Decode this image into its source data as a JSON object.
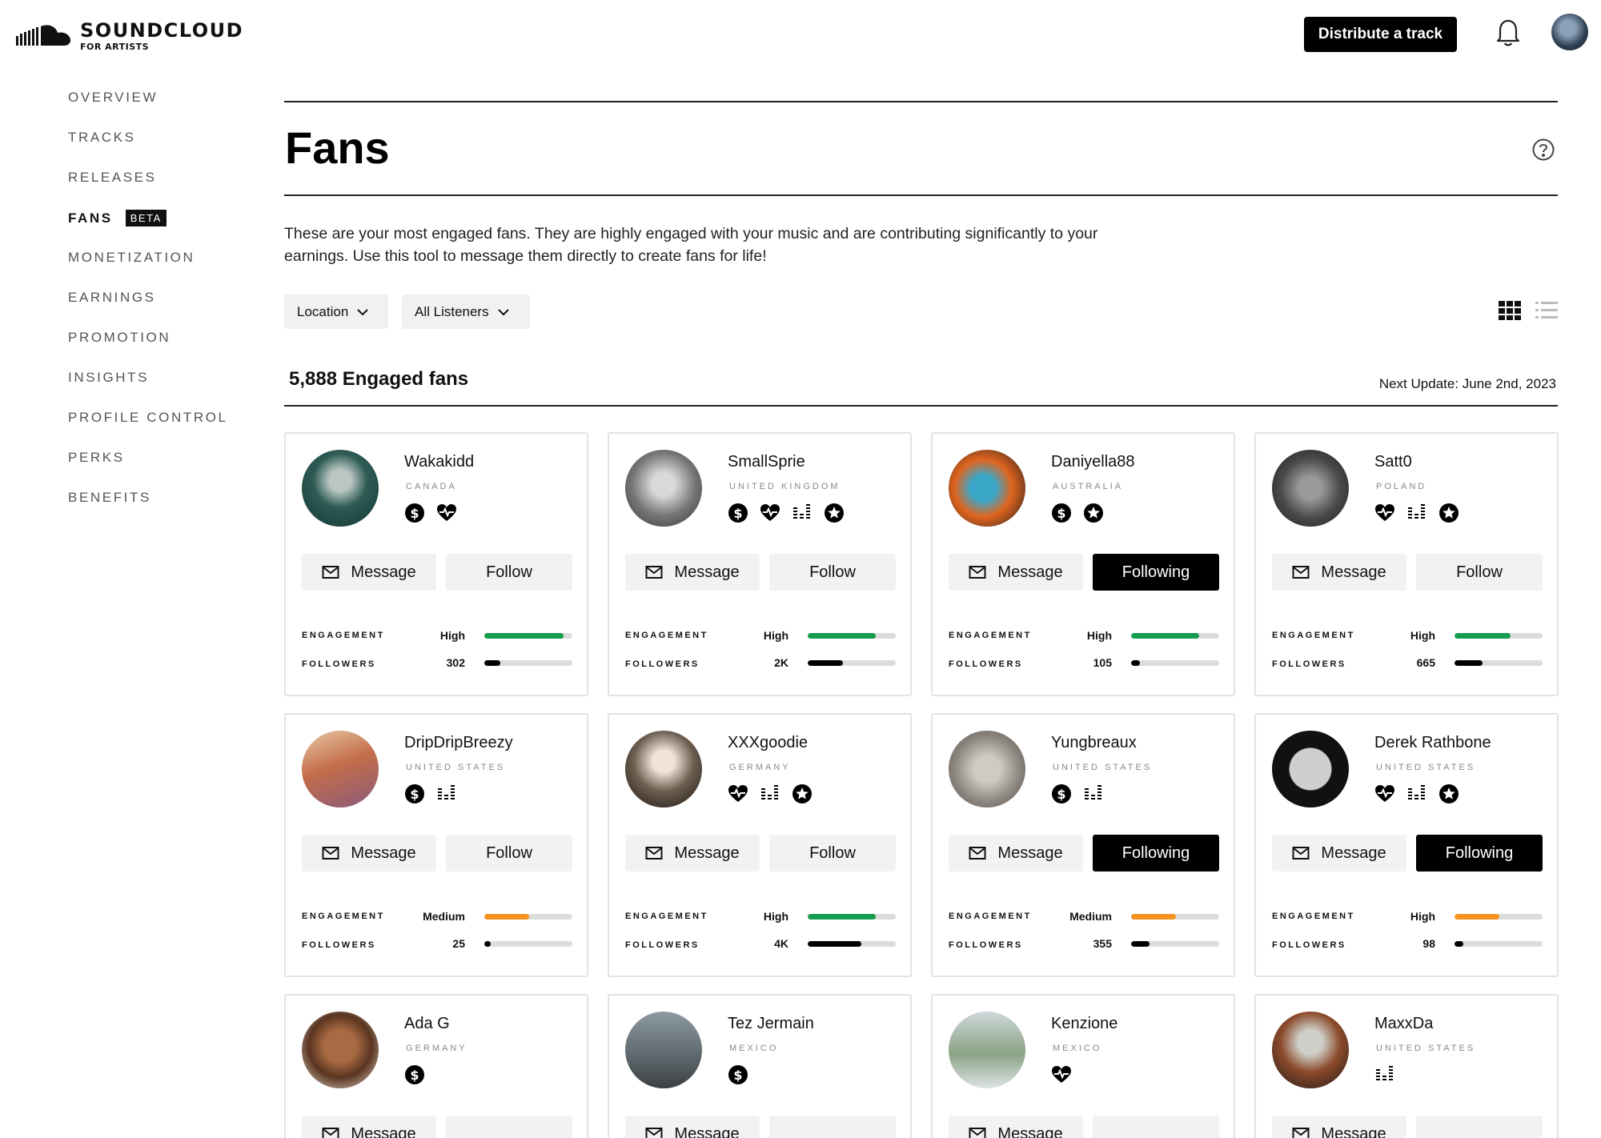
{
  "brand": {
    "name": "SOUNDCLOUD",
    "sub": "FOR ARTISTS"
  },
  "header": {
    "distribute_label": "Distribute a track"
  },
  "sidebar": {
    "items": [
      {
        "label": "OVERVIEW"
      },
      {
        "label": "TRACKS"
      },
      {
        "label": "RELEASES"
      },
      {
        "label": "FANS",
        "badge": "BETA",
        "active": true
      },
      {
        "label": "MONETIZATION"
      },
      {
        "label": "EARNINGS"
      },
      {
        "label": "PROMOTION"
      },
      {
        "label": "INSIGHTS"
      },
      {
        "label": "PROFILE CONTROL"
      },
      {
        "label": "PERKS"
      },
      {
        "label": "BENEFITS"
      }
    ]
  },
  "page": {
    "title": "Fans",
    "description": "These are your most engaged fans. They are highly engaged with your music and are contributing significantly to your earnings.  Use this tool to message them directly to create fans for life!",
    "filters": {
      "location": "Location",
      "listeners": "All Listeners"
    },
    "count": "5,888 Engaged fans",
    "next_update": "Next Update: June 2nd, 2023"
  },
  "labels": {
    "message": "Message",
    "engagement": "ENGAGEMENT",
    "followers": "FOLLOWERS"
  },
  "colors": {
    "green": "#149c4f",
    "orange": "#f6931e",
    "black": "#000000",
    "track": "#dcdcdc"
  },
  "fans": [
    {
      "name": "Wakakidd",
      "country": "CANADA",
      "badges": [
        "dollar-icon",
        "heart-icon"
      ],
      "follow": "Follow",
      "following": false,
      "engagement": "High",
      "engagement_level": 0.9,
      "engagement_color": "green",
      "followers": "302",
      "followers_level": 0.18
    },
    {
      "name": "SmallSprie",
      "country": "UNITED KINGDOM",
      "badges": [
        "dollar-icon",
        "heart-icon",
        "equalizer-icon",
        "star-icon"
      ],
      "follow": "Follow",
      "following": false,
      "engagement": "High",
      "engagement_level": 0.77,
      "engagement_color": "green",
      "followers": "2K",
      "followers_level": 0.4
    },
    {
      "name": "Daniyella88",
      "country": "AUSTRALIA",
      "badges": [
        "dollar-icon",
        "star-icon"
      ],
      "follow": "Following",
      "following": true,
      "engagement": "High",
      "engagement_level": 0.77,
      "engagement_color": "green",
      "followers": "105",
      "followers_level": 0.1
    },
    {
      "name": "Satt0",
      "country": "POLAND",
      "badges": [
        "heart-icon",
        "equalizer-icon",
        "star-icon"
      ],
      "follow": "Follow",
      "following": false,
      "engagement": "High",
      "engagement_level": 0.64,
      "engagement_color": "green",
      "followers": "665",
      "followers_level": 0.32
    },
    {
      "name": "DripDripBreezy",
      "country": "UNITED STATES",
      "badges": [
        "dollar-icon",
        "equalizer-icon"
      ],
      "follow": "Follow",
      "following": false,
      "engagement": "Medium",
      "engagement_level": 0.51,
      "engagement_color": "orange",
      "followers": "25",
      "followers_level": 0.07
    },
    {
      "name": "XXXgoodie",
      "country": "GERMANY",
      "badges": [
        "heart-icon",
        "equalizer-icon",
        "star-icon"
      ],
      "follow": "Follow",
      "following": false,
      "engagement": "High",
      "engagement_level": 0.77,
      "engagement_color": "green",
      "followers": "4K",
      "followers_level": 0.61
    },
    {
      "name": "Yungbreaux",
      "country": "UNITED STATES",
      "badges": [
        "dollar-icon",
        "equalizer-icon"
      ],
      "follow": "Following",
      "following": true,
      "engagement": "Medium",
      "engagement_level": 0.51,
      "engagement_color": "orange",
      "followers": "355",
      "followers_level": 0.21
    },
    {
      "name": "Derek Rathbone",
      "country": "UNITED STATES",
      "badges": [
        "heart-icon",
        "equalizer-icon",
        "star-icon"
      ],
      "follow": "Following",
      "following": true,
      "engagement": "High",
      "engagement_level": 0.51,
      "engagement_color": "orange",
      "followers": "98",
      "followers_level": 0.1
    },
    {
      "name": "Ada G",
      "country": "GERMANY",
      "badges": [
        "dollar-icon"
      ]
    },
    {
      "name": "Tez Jermain",
      "country": "MEXICO",
      "badges": [
        "dollar-icon"
      ]
    },
    {
      "name": "Kenzione",
      "country": "MEXICO",
      "badges": [
        "heart-icon"
      ]
    },
    {
      "name": "MaxxDa",
      "country": "UNITED STATES",
      "badges": [
        "equalizer-icon"
      ]
    }
  ]
}
